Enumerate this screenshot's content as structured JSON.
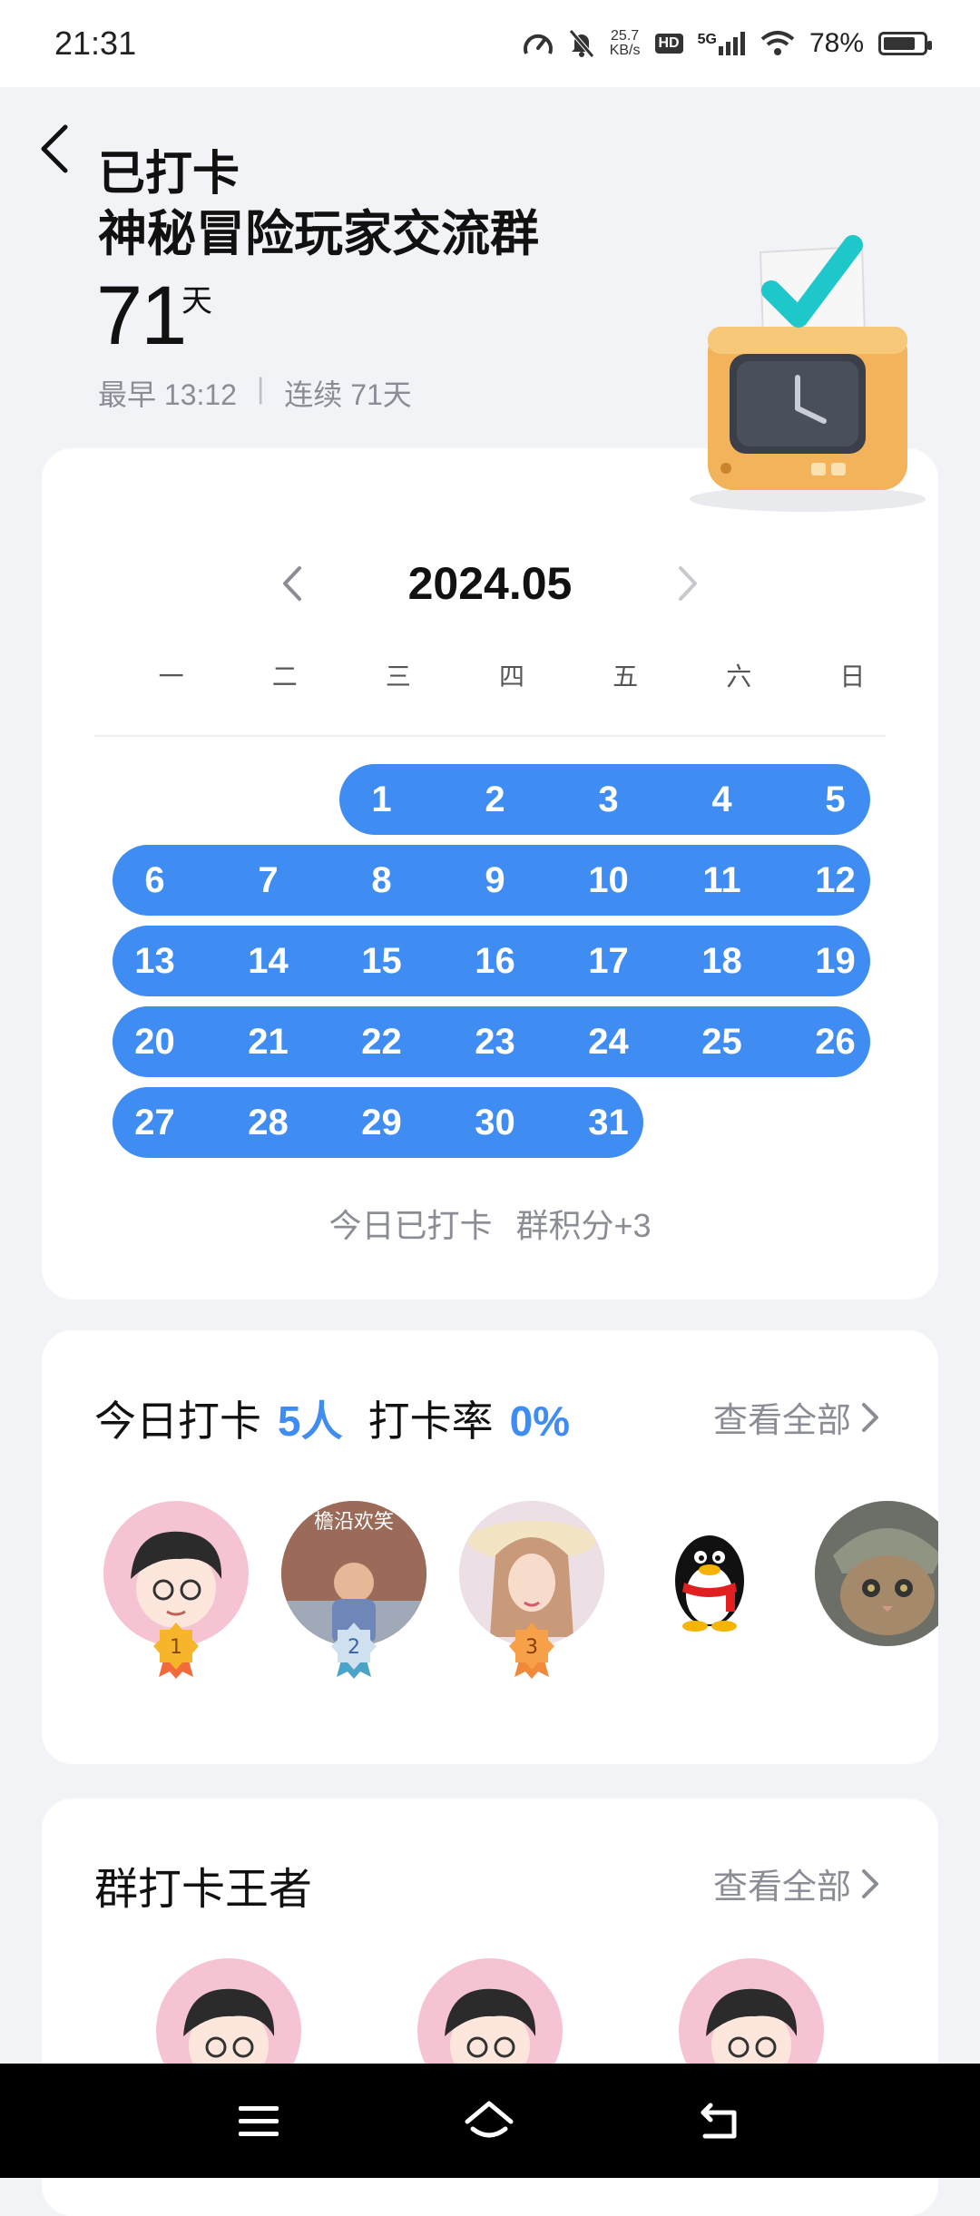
{
  "status": {
    "time": "21:31",
    "speed_value": "25.7",
    "speed_unit": "KB/s",
    "hd": "HD",
    "network": "5G",
    "battery": "78%",
    "battery_level": 0.78
  },
  "header": {
    "title": "已打卡",
    "group_name": "神秘冒险玩家交流群",
    "days": "71",
    "days_unit": "天",
    "earliest": "最早 13:12",
    "separator": "|",
    "streak": "连续 71天"
  },
  "calendar": {
    "month": "2024.05",
    "weekdays": [
      "一",
      "二",
      "三",
      "四",
      "五",
      "六",
      "日"
    ],
    "checked_days": [
      1,
      2,
      3,
      4,
      5,
      6,
      7,
      8,
      9,
      10,
      11,
      12,
      13,
      14,
      15,
      16,
      17,
      18,
      19,
      20,
      21,
      22,
      23,
      24,
      25,
      26,
      27,
      28,
      29,
      30,
      31
    ],
    "first_weekday_index": 2,
    "today_status": "今日已打卡",
    "points": "群积分+3"
  },
  "today": {
    "label": "今日打卡",
    "count": "5人",
    "rate_label": "打卡率",
    "rate": "0%",
    "view_all": "查看全部",
    "medals": [
      "1",
      "2",
      "3"
    ],
    "avatar_caption": "檐沿欢笑"
  },
  "kings": {
    "title": "群打卡王者",
    "view_all": "查看全部"
  },
  "colors": {
    "accent": "#3f8cf2",
    "muted": "#8a8d95",
    "background": "#f2f3f7"
  }
}
